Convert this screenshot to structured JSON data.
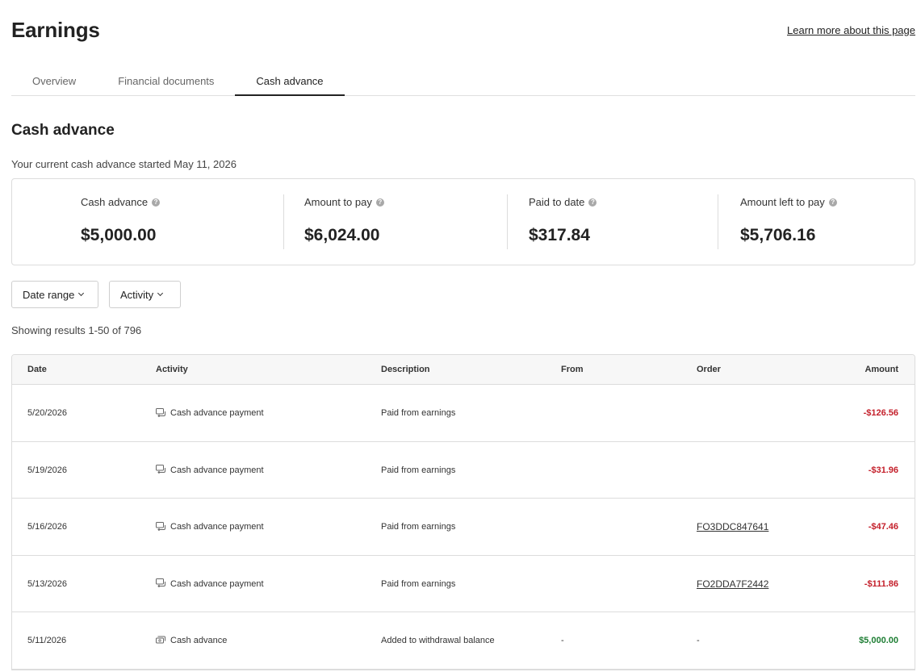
{
  "header": {
    "title": "Earnings",
    "learn_more": "Learn more about this page"
  },
  "tabs": [
    {
      "label": "Overview",
      "active": false
    },
    {
      "label": "Financial documents",
      "active": false
    },
    {
      "label": "Cash advance",
      "active": true
    }
  ],
  "section": {
    "title": "Cash advance",
    "started_text": "Your current cash advance started May 11, 2026"
  },
  "summary": [
    {
      "label": "Cash advance",
      "value": "$5,000.00"
    },
    {
      "label": "Amount to pay",
      "value": "$6,024.00"
    },
    {
      "label": "Paid to date",
      "value": "$317.84"
    },
    {
      "label": "Amount left to pay",
      "value": "$5,706.16"
    }
  ],
  "filters": {
    "date_range": "Date range",
    "activity": "Activity"
  },
  "results_text": "Showing results 1-50 of 796",
  "table": {
    "columns": [
      "Date",
      "Activity",
      "Description",
      "From",
      "Order",
      "Amount"
    ],
    "rows": [
      {
        "date": "5/20/2026",
        "activity": "Cash advance payment",
        "description": "Paid from earnings",
        "from": "",
        "order": "",
        "amount": "-$126.56"
      },
      {
        "date": "5/19/2026",
        "activity": "Cash advance payment",
        "description": "Paid from earnings",
        "from": "",
        "order": "",
        "amount": "-$31.96"
      },
      {
        "date": "5/16/2026",
        "activity": "Cash advance payment",
        "description": "Paid from earnings",
        "from": "",
        "order": "FO3DDC847641",
        "amount": "-$47.46"
      },
      {
        "date": "5/13/2026",
        "activity": "Cash advance payment",
        "description": "Paid from earnings",
        "from": "",
        "order": "FO2DDA7F2442",
        "amount": "-$111.86"
      },
      {
        "date": "5/11/2026",
        "activity": "Cash advance",
        "description": "Added to withdrawal balance",
        "from": "-",
        "order": "-",
        "amount": "$5,000.00"
      }
    ]
  },
  "colors": {
    "negative": "#c4202b",
    "positive": "#1e7e34",
    "border": "#dcdcdc"
  },
  "icons": {
    "payment": "repeat-payment-icon",
    "advance": "cash-stack-icon",
    "help": "question-circle-icon"
  }
}
